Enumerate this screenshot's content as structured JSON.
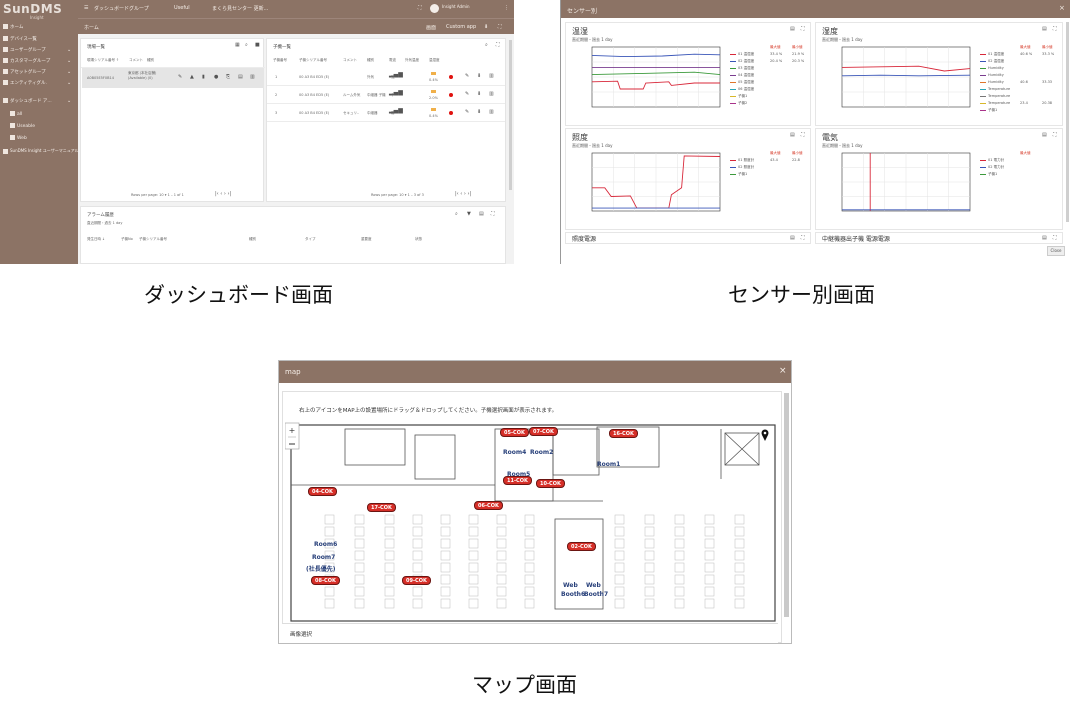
{
  "captions": {
    "dashboard": "ダッシュボード画面",
    "sensor": "センサー別画面",
    "map": "マップ画面"
  },
  "dashboard": {
    "logo": "SunDMS",
    "logo_sub": "Insight",
    "breadcrumb": [
      "ダッシュボードグループ",
      "Useful",
      "まくら見センター 更新..."
    ],
    "subbar_title": "ホーム",
    "subbar_right": [
      "画面",
      "Custom app"
    ],
    "user": "Insight Admin",
    "sidebar": [
      {
        "label": "ホーム",
        "sub": false,
        "chev": false
      },
      {
        "label": "デバイス一覧",
        "sub": false,
        "chev": false
      },
      {
        "label": "ユーザーグループ",
        "sub": false,
        "chev": true
      },
      {
        "label": "カスタマーグループ",
        "sub": false,
        "chev": true
      },
      {
        "label": "アセットグループ",
        "sub": false,
        "chev": true
      },
      {
        "label": "エンティティグル.",
        "sub": false,
        "chev": true
      },
      {
        "label": "ダッシュボード ア...",
        "sub": false,
        "chev": true
      },
      {
        "label": "all",
        "sub": true,
        "chev": false
      },
      {
        "label": "Useable",
        "sub": true,
        "chev": false
      },
      {
        "label": "Web",
        "sub": true,
        "chev": false
      },
      {
        "label": "SunDMS Insight ユーザーマニュアル",
        "sub": false,
        "chev": false
      }
    ],
    "left_card": {
      "title": "現場一覧",
      "headers": [
        "現場シリアル番号 ↑",
        "コメント",
        "種別"
      ],
      "row": [
        "A0B05E5F0B14",
        "東京都 (本社店舗) (Available) (0)",
        ""
      ],
      "pager": "Rows per page: 10 ▾  1 – 1 of 1"
    },
    "right_card": {
      "title": "子機一覧",
      "headers": [
        "子機番号",
        "子機シリアル番号",
        "コメント",
        "種別",
        "電波",
        "外気温度",
        "温湿度"
      ],
      "rows": [
        {
          "num": "1",
          "serial": "00 A3 B4 ED5 (E)",
          "comment": "",
          "type": "外気",
          "rssi": "強",
          "temp": "0.4%"
        },
        {
          "num": "2",
          "serial": "00 A3 B4 ED5 (E)",
          "comment": "ルーム外気",
          "type": "中継器 子機",
          "rssi": "中",
          "temp": "2.0%"
        },
        {
          "num": "3",
          "serial": "00 A3 B4 ED5 (E)",
          "comment": "セキュリ..",
          "type": "中継器",
          "rssi": "弱",
          "temp": "0.4%"
        }
      ],
      "pager": "Rows per page: 10 ▾  1 – 3 of 3"
    },
    "alarm_card": {
      "title": "アラーム履歴",
      "subtitle": "直近期間・過去 1 day",
      "headers": [
        "発生日時 ↓",
        "子機No",
        "子機シリアル番号",
        "種別",
        "タイプ",
        "重要度",
        "状態"
      ]
    }
  },
  "sensor": {
    "header": "センサー別",
    "cards": [
      {
        "title": "温湿",
        "subtitle": "直近期間・過去 1 day",
        "legend": [
          "01 温湿度",
          "02 温湿度",
          "03 温湿度",
          "04 温湿度",
          "05 温湿度",
          "06 温湿度",
          "子機1",
          "子機2"
        ],
        "cols": [
          "最大値",
          "最小値"
        ],
        "vals": [
          [
            "33.4 %",
            "21.9 %"
          ],
          [
            "20.4 %",
            "20.3 %"
          ],
          [
            "",
            ""
          ],
          [
            "",
            ""
          ],
          [
            "",
            ""
          ],
          [
            "",
            ""
          ],
          [
            "",
            ""
          ],
          [
            "",
            ""
          ]
        ]
      },
      {
        "title": "湿度",
        "subtitle": "直近期間・過去 1 day",
        "legend": [
          "01 温湿度",
          "02 温湿度",
          "Humidity",
          "Humidity",
          "Humidity",
          "Temperature",
          "Temperature",
          "Temperature",
          "子機1"
        ],
        "cols": [
          "最大値",
          "最小値"
        ],
        "vals": [
          [
            "40.6 %",
            "33.3 %"
          ],
          [
            "",
            ""
          ],
          [
            "",
            ""
          ],
          [
            "",
            ""
          ],
          [
            "40.6",
            "33.33"
          ],
          [
            "",
            ""
          ],
          [
            "",
            ""
          ],
          [
            "23.4",
            "20.38"
          ],
          [
            "",
            ""
          ]
        ]
      },
      {
        "title": "照度",
        "subtitle": "直近期間・過去 1 day",
        "legend": [
          "01 照度計",
          "02 照度計",
          "子機1"
        ],
        "cols": [
          "最大値",
          "最小値"
        ],
        "vals": [
          [
            "43.4",
            "22.8"
          ],
          [
            "",
            ""
          ],
          [
            "",
            ""
          ]
        ]
      },
      {
        "title": "電気",
        "subtitle": "直近期間・過去 1 day",
        "legend": [
          "01 電力計",
          "02 電力計",
          "子機1"
        ],
        "cols": [
          "最大値"
        ],
        "vals": [
          [
            "",
            ""
          ],
          [
            "",
            ""
          ],
          [
            "",
            ""
          ]
        ]
      }
    ],
    "more_cards": [
      "照度電源",
      "中継機器出子機 電源電源"
    ]
  },
  "map": {
    "header": "map",
    "instruction": "右上のアイコンをMAP上の設置場所にドラッグ＆ドロップしてください。子機選択画面が表示されます。",
    "zoom": "+",
    "footer_label": "画像選択",
    "pins": [
      "05-COK",
      "07-COK",
      "16-COK",
      "11-COK",
      "10-COK",
      "04-COK",
      "06-COK",
      "17-COK",
      "02-COK",
      "08-COK",
      "09-COK"
    ],
    "rooms": [
      "Room4",
      "Room2",
      "Room5",
      "Room1",
      "Room6",
      "Room7",
      "(社長優先)",
      "Web",
      "Web",
      "Booth6",
      "Booth7"
    ]
  }
}
